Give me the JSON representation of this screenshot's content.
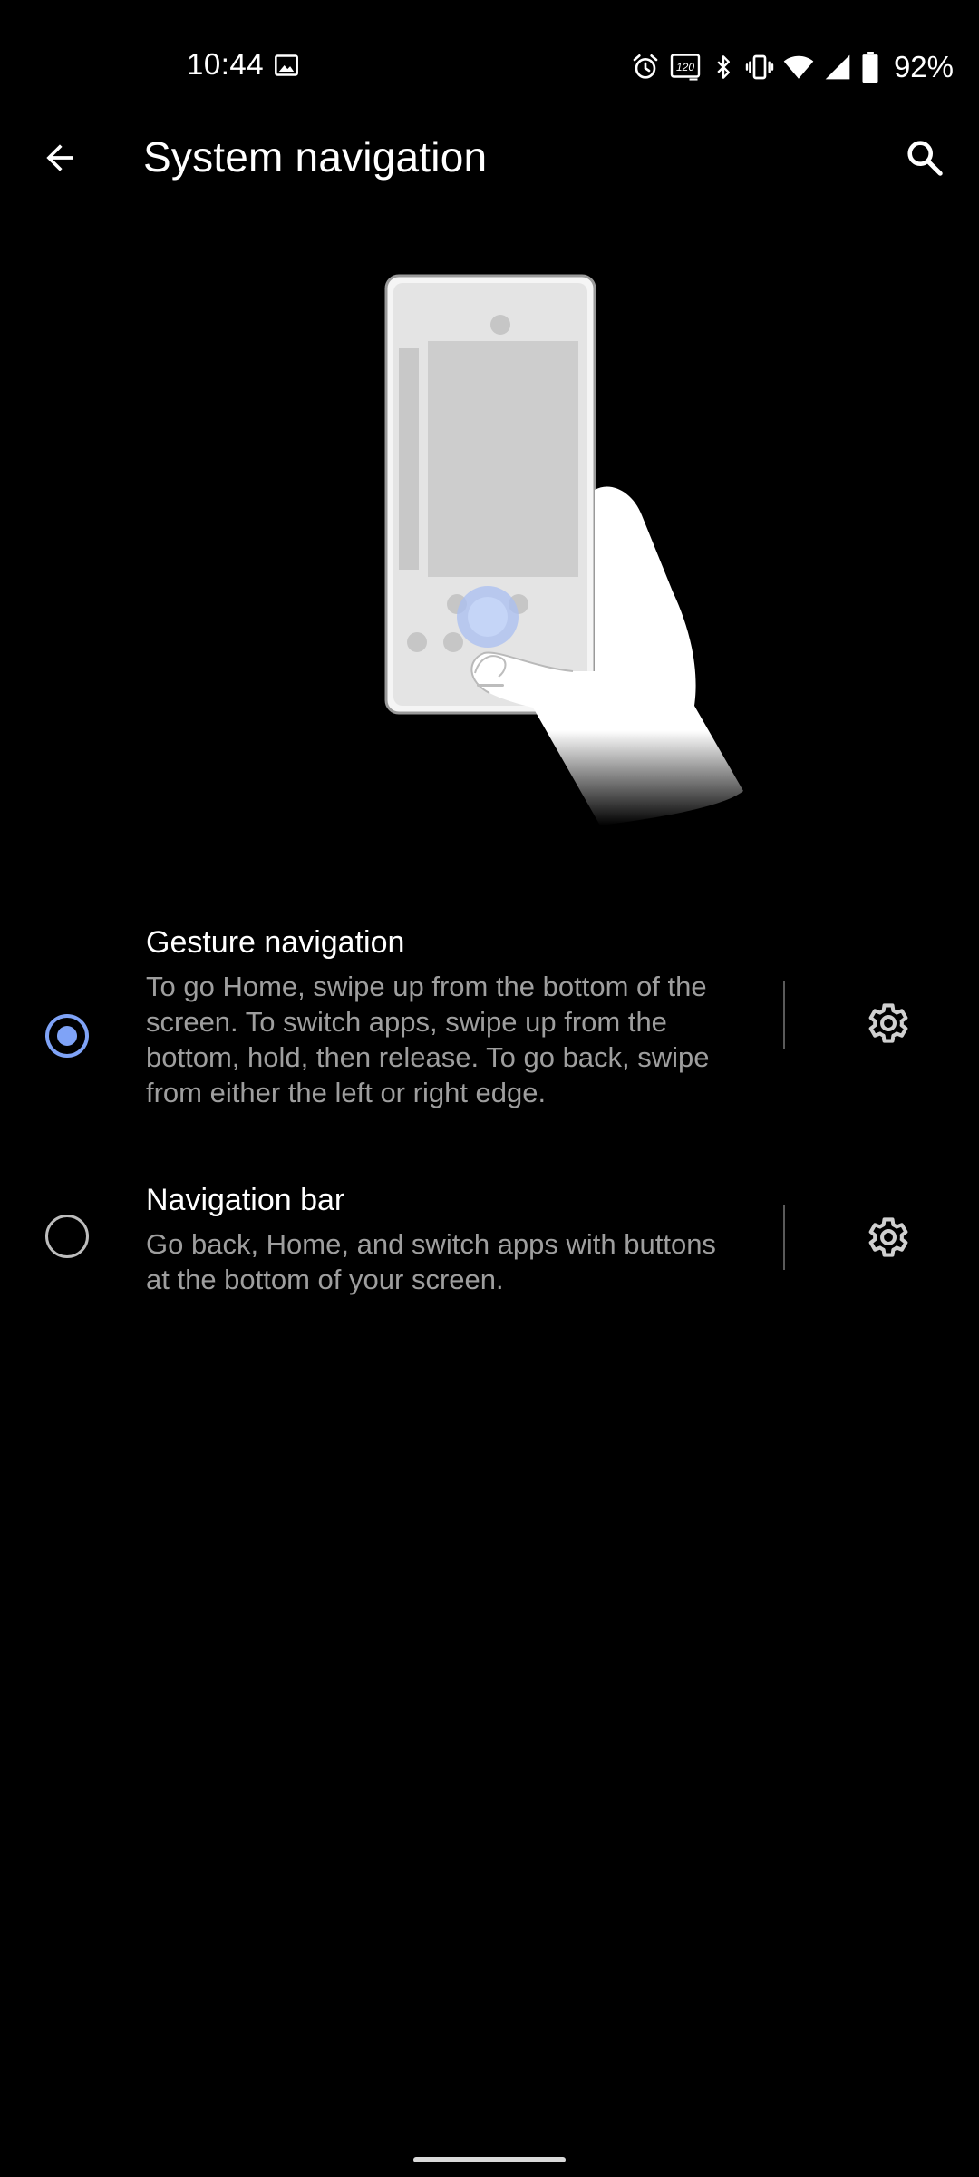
{
  "status_bar": {
    "time": "10:44",
    "battery_percent": "92%",
    "icons": [
      "gallery-icon",
      "alarm-icon",
      "refresh-rate-120hz-icon",
      "bluetooth-icon",
      "vibrate-icon",
      "wifi-icon",
      "signal-icon",
      "battery-icon"
    ],
    "refresh_rate_label": "120"
  },
  "app_bar": {
    "title": "System navigation",
    "back_icon": "arrow-back-icon",
    "search_icon": "search-icon"
  },
  "illustration": {
    "icon": "phone-in-hand-gesture-illustration"
  },
  "options": [
    {
      "title": "Gesture navigation",
      "description": "To go Home, swipe up from the bottom of the screen. To switch apps, swipe up from the bottom, hold, then release. To go back, swipe from either the left or right edge.",
      "selected": true,
      "settings_icon": "gear-icon"
    },
    {
      "title": "Navigation bar",
      "description": "Go back, Home, and switch apps with buttons at the bottom of your screen.",
      "selected": false,
      "settings_icon": "gear-icon"
    }
  ],
  "colors": {
    "background": "#000000",
    "accent": "#7fa3f7",
    "primary_text": "#ffffff",
    "secondary_text": "#9e9e9e",
    "divider": "#5a5a5a"
  }
}
